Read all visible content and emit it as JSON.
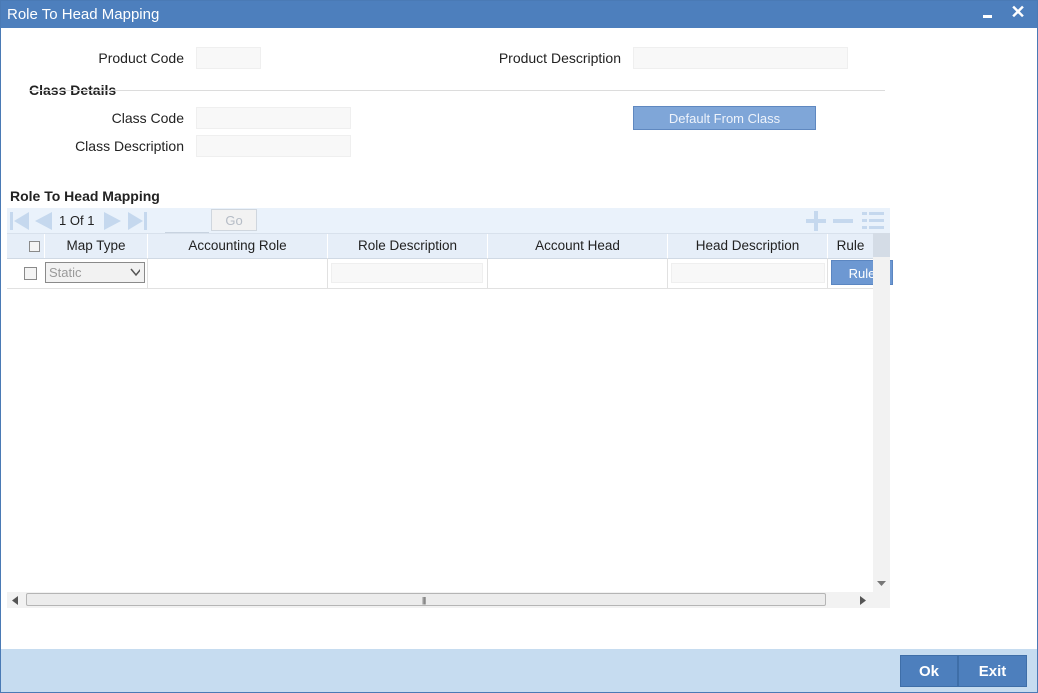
{
  "window": {
    "title": "Role To Head Mapping"
  },
  "header": {
    "product_code_label": "Product Code",
    "product_code_value": "",
    "product_description_label": "Product Description",
    "product_description_value": ""
  },
  "class_details": {
    "heading": "Class Details",
    "class_code_label": "Class Code",
    "class_code_value": "",
    "class_description_label": "Class Description",
    "class_description_value": "",
    "default_button": "Default From Class"
  },
  "grid": {
    "heading": "Role To Head Mapping",
    "pager": {
      "current": "1",
      "of_label": "Of",
      "total": "1"
    },
    "go_button": "Go",
    "columns": [
      "Map Type",
      "Accounting Role",
      "Role Description",
      "Account Head",
      "Head Description",
      "Rule"
    ],
    "rows": [
      {
        "map_type": "Static",
        "accounting_role": "",
        "role_description": "",
        "account_head": "",
        "head_description": "",
        "rule_button": "Rule"
      }
    ]
  },
  "footer": {
    "ok_label": "Ok",
    "exit_label": "Exit"
  },
  "colors": {
    "titlebar": "#4d7fbd",
    "footer_bg": "#c6dcf0",
    "accent_button": "#6d98d2",
    "grid_header": "#e6eef8"
  },
  "icons": [
    "minimize-icon",
    "close-icon",
    "first-page-icon",
    "prev-page-icon",
    "next-page-icon",
    "last-page-icon",
    "add-row-icon",
    "delete-row-icon",
    "single-view-icon",
    "dropdown-arrow-icon"
  ]
}
